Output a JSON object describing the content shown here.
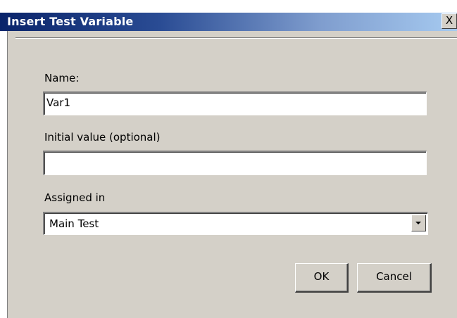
{
  "window": {
    "title": "Insert Test Variable",
    "close_glyph": "X"
  },
  "fields": {
    "name_label": "Name:",
    "name_value": "Var1",
    "initial_label": "Initial value (optional)",
    "initial_value": "",
    "assigned_label": "Assigned in",
    "assigned_value": "Main Test"
  },
  "buttons": {
    "ok_label": "OK",
    "cancel_label": "Cancel"
  },
  "colors": {
    "title_start": "#0a246a",
    "title_end": "#a6caf0",
    "face": "#d4d0c8"
  }
}
